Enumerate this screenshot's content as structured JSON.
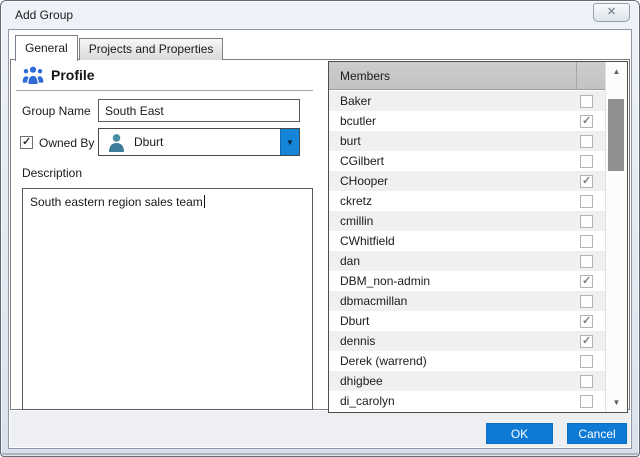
{
  "window": {
    "title": "Add Group"
  },
  "icons": {
    "close": "✕",
    "dropdown_arrow": "▼",
    "scroll_up": "▲",
    "scroll_down": "▼",
    "check": "✓"
  },
  "colors": {
    "accent_blue": "#0d7bd6",
    "combo_blue": "#1585d8",
    "profile_icon_blue": "#2e6bd6",
    "person_icon_teal": "#3f7e9d",
    "header_gray": "#c8c8c8",
    "row_alt_gray": "#f0f0f0"
  },
  "tabs": [
    {
      "label": "General",
      "active": true
    },
    {
      "label": "Projects and Properties",
      "active": false
    }
  ],
  "profile": {
    "heading": "Profile"
  },
  "form": {
    "group_name_label": "Group Name",
    "group_name_value": "South East",
    "owned_by_label": "Owned By",
    "owned_by_checked": true,
    "owner_value": "Dburt",
    "description_label": "Description",
    "description_value": "South eastern region sales team"
  },
  "members": {
    "header": "Members",
    "rows": [
      {
        "name": "Baker",
        "checked": false
      },
      {
        "name": "bcutler",
        "checked": true
      },
      {
        "name": "burt",
        "checked": false
      },
      {
        "name": "CGilbert",
        "checked": false
      },
      {
        "name": "CHooper",
        "checked": true
      },
      {
        "name": "ckretz",
        "checked": false
      },
      {
        "name": "cmillin",
        "checked": false
      },
      {
        "name": "CWhitfield",
        "checked": false
      },
      {
        "name": "dan",
        "checked": false
      },
      {
        "name": "DBM_non-admin",
        "checked": true
      },
      {
        "name": "dbmacmillan",
        "checked": false
      },
      {
        "name": "Dburt",
        "checked": true
      },
      {
        "name": "dennis",
        "checked": true
      },
      {
        "name": "Derek (warrend)",
        "checked": false
      },
      {
        "name": "dhigbee",
        "checked": false
      },
      {
        "name": "di_carolyn",
        "checked": false
      }
    ]
  },
  "footer": {
    "ok_label": "OK",
    "cancel_label": "Cancel"
  }
}
